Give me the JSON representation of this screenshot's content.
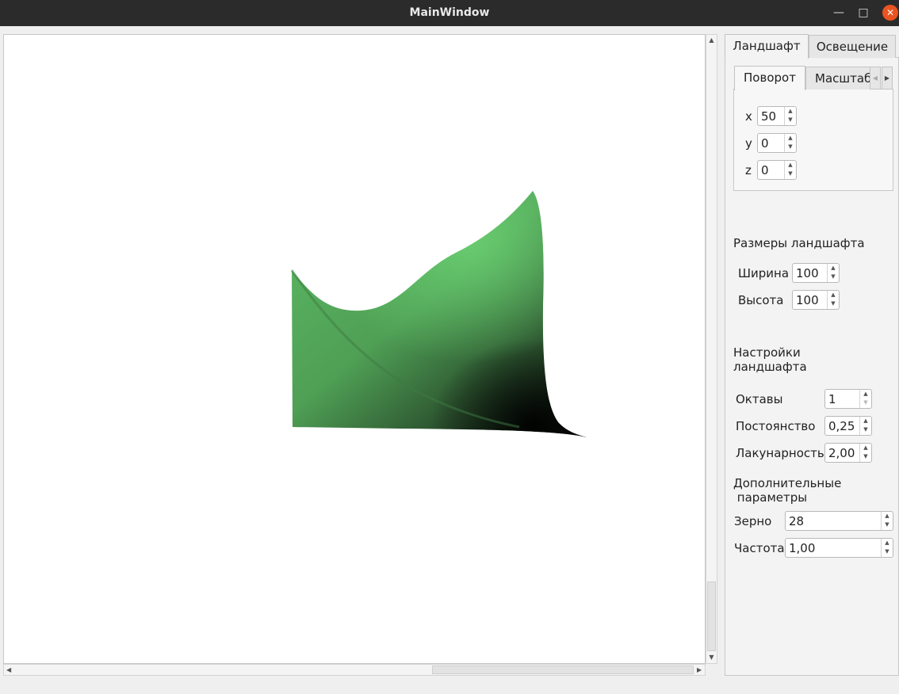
{
  "window": {
    "title": "MainWindow"
  },
  "tabs": {
    "landscape": "Ландшафт",
    "lighting": "Освещение"
  },
  "inner_tabs": {
    "rotation": "Поворот",
    "scale": "Масштаб"
  },
  "rotation": {
    "x_label": "x",
    "x_value": "50",
    "y_label": "y",
    "y_value": "0",
    "z_label": "z",
    "z_value": "0"
  },
  "size": {
    "heading": "Размеры ландшафта",
    "width_label": "Ширина",
    "width_value": "100",
    "height_label": "Высота",
    "height_value": "100"
  },
  "settings": {
    "heading_line1": "Настройки",
    "heading_line2": "ландшафта",
    "octaves_label": "Октавы",
    "octaves_value": "1",
    "persistence_label": "Постоянство",
    "persistence_value": "0,25",
    "lacunarity_label": "Лакунарность",
    "lacunarity_value": "2,00"
  },
  "extra": {
    "heading_line1": "Дополнительные",
    "heading_line2": " параметры",
    "seed_label": "Зерно",
    "seed_value": "28",
    "frequency_label": "Частота",
    "frequency_value": "1,00"
  },
  "colors": {
    "terrain": "#64c46c",
    "titlebar": "#2b2b2b",
    "close": "#e95420"
  }
}
